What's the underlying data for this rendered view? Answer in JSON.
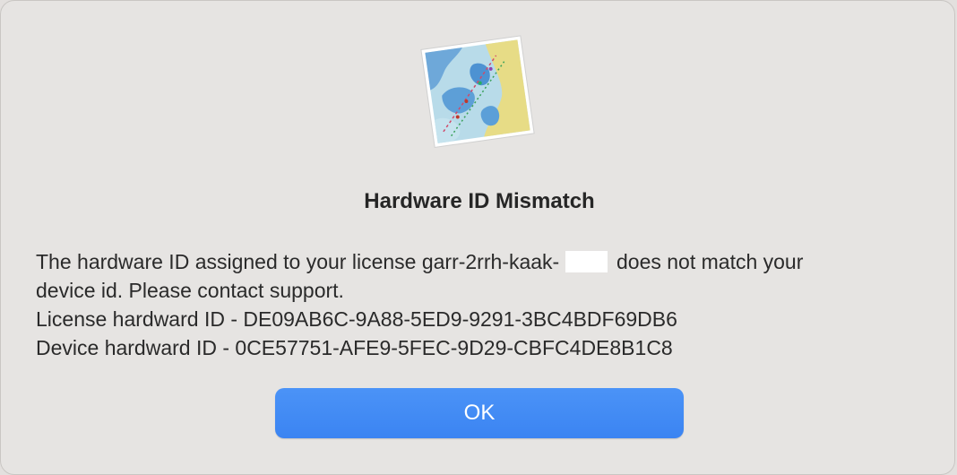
{
  "dialog": {
    "icon": "nautical-chart-icon",
    "title": "Hardware ID Mismatch",
    "message": {
      "line1_before": "The hardware ID assigned to your license garr-2rrh-kaak-",
      "line1_after": "does not match your",
      "line2": "device id. Please contact support.",
      "line3": "License hardward ID - DE09AB6C-9A88-5ED9-9291-3BC4BDF69DB6",
      "line4": "Device hardward ID - 0CE57751-AFE9-5FEC-9D29-CBFC4DE8B1C8"
    },
    "ok_label": "OK"
  },
  "colors": {
    "button": "#3b84f2",
    "background": "#e6e4e2",
    "text": "#262626"
  }
}
